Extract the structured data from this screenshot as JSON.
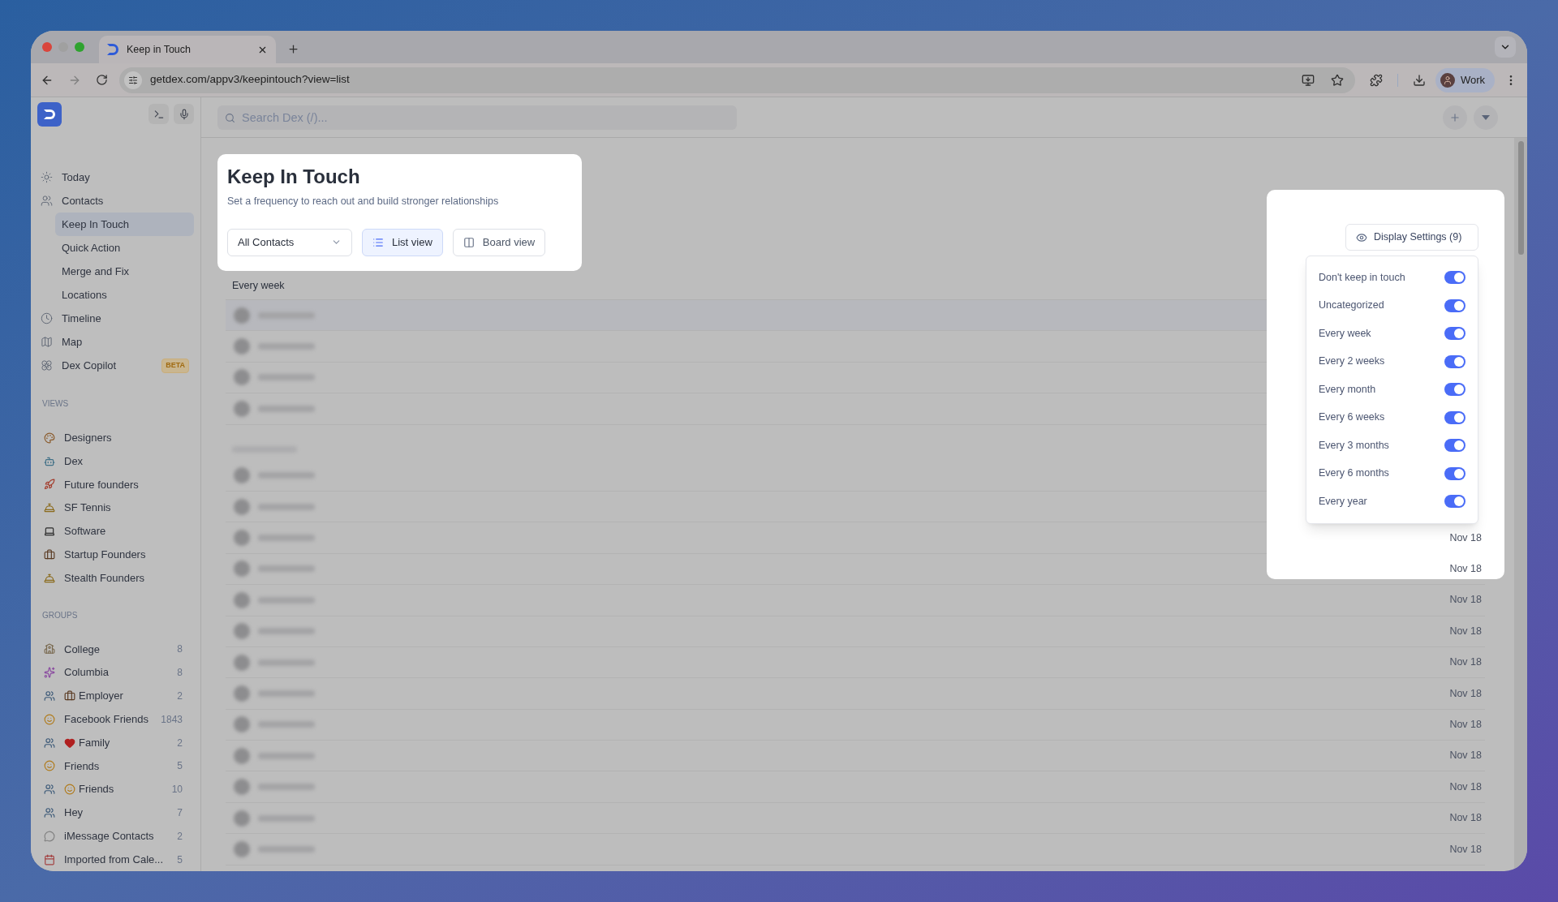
{
  "browser": {
    "tab": {
      "title": "Keep in Touch"
    },
    "url": "getdex.com/appv3/keepintouch?view=list",
    "profile": "Work"
  },
  "sidebar": {
    "nav": [
      {
        "label": "Today",
        "selected": false
      },
      {
        "label": "Contacts",
        "selected": false,
        "children": [
          {
            "label": "Keep In Touch",
            "selected": true
          },
          {
            "label": "Quick Action",
            "selected": false
          },
          {
            "label": "Merge and Fix",
            "selected": false
          },
          {
            "label": "Locations",
            "selected": false
          }
        ]
      },
      {
        "label": "Timeline",
        "selected": false
      },
      {
        "label": "Map",
        "selected": false
      },
      {
        "label": "Dex Copilot",
        "selected": false,
        "badge": "BETA"
      }
    ],
    "views": {
      "heading": "VIEWS",
      "items": [
        {
          "label": "Designers"
        },
        {
          "label": "Dex"
        },
        {
          "label": "Future founders"
        },
        {
          "label": "SF Tennis"
        },
        {
          "label": "Software"
        },
        {
          "label": "Startup Founders"
        },
        {
          "label": "Stealth Founders"
        }
      ]
    },
    "groups": {
      "heading": "GROUPS",
      "items": [
        {
          "label": "College",
          "count": "8"
        },
        {
          "label": "Columbia",
          "count": "8"
        },
        {
          "label": "Employer",
          "count": "2"
        },
        {
          "label": "Facebook Friends",
          "count": "1843"
        },
        {
          "label": "Family",
          "count": "2"
        },
        {
          "label": "Friends",
          "count": "5"
        },
        {
          "label": "Friends",
          "count": "10"
        },
        {
          "label": "Hey",
          "count": "7"
        },
        {
          "label": "iMessage Contacts",
          "count": "2"
        },
        {
          "label": "Imported from Cale...",
          "count": "5"
        }
      ]
    }
  },
  "search": {
    "placeholder": "Search Dex (/)..."
  },
  "header": {
    "title": "Keep In Touch",
    "subtitle": "Set a frequency to reach out and build stronger relationships",
    "filter": "All Contacts",
    "views": [
      {
        "label": "List view",
        "selected": true
      },
      {
        "label": "Board view",
        "selected": false
      }
    ]
  },
  "list": {
    "sections": [
      {
        "title": "Every week",
        "rows": [
          {
            "kind": "blurred"
          },
          {
            "kind": "blurred"
          },
          {
            "kind": "blurred"
          },
          {
            "kind": "blurred"
          }
        ]
      },
      {
        "rows": [
          {
            "kind": "blurred"
          },
          {
            "kind": "blurred"
          },
          {
            "kind": "blurred",
            "date": "Nov 18"
          },
          {
            "kind": "blurred",
            "date": "Nov 18"
          },
          {
            "kind": "blurred",
            "date": "Nov 18"
          },
          {
            "kind": "blurred",
            "date": "Nov 18"
          },
          {
            "kind": "blurred",
            "date": "Nov 18"
          },
          {
            "kind": "blurred",
            "date": "Nov 18"
          },
          {
            "kind": "blurred",
            "date": "Nov 18"
          },
          {
            "kind": "blurred",
            "date": "Nov 18"
          },
          {
            "kind": "blurred",
            "date": "Nov 18"
          },
          {
            "kind": "blurred",
            "date": "Nov 18"
          },
          {
            "kind": "blurred",
            "date": "Nov 18"
          }
        ]
      }
    ]
  },
  "display_settings": {
    "button": "Display Settings (9)",
    "options": [
      {
        "label": "Don't keep in touch",
        "on": true
      },
      {
        "label": "Uncategorized",
        "on": true
      },
      {
        "label": "Every week",
        "on": true
      },
      {
        "label": "Every 2 weeks",
        "on": true
      },
      {
        "label": "Every month",
        "on": true
      },
      {
        "label": "Every 6 weeks",
        "on": true
      },
      {
        "label": "Every 3 months",
        "on": true
      },
      {
        "label": "Every 6 months",
        "on": true
      },
      {
        "label": "Every year",
        "on": true
      }
    ]
  }
}
